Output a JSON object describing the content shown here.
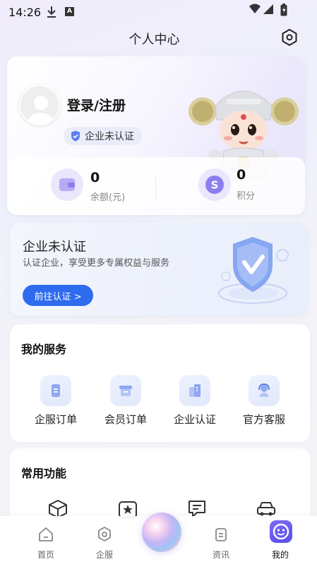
{
  "status_bar": {
    "time": "14:26"
  },
  "header": {
    "title": "个人中心"
  },
  "profile": {
    "login_text": "登录/注册",
    "cert_badge": "企业未认证",
    "balance_value": "0",
    "balance_label": "余额(元)",
    "points_value": "0",
    "points_label": "积分"
  },
  "enterprise": {
    "title": "企业未认证",
    "subtitle": "认证企业，享受更多专属权益与服务",
    "button": "前往认证 >"
  },
  "services": {
    "title": "我的服务",
    "items": [
      {
        "label": "企服订单",
        "icon": "document-icon"
      },
      {
        "label": "会员订单",
        "icon": "box-icon"
      },
      {
        "label": "企业认证",
        "icon": "building-icon"
      },
      {
        "label": "官方客服",
        "icon": "headset-icon"
      }
    ]
  },
  "functions": {
    "title": "常用功能",
    "icons": [
      "package-icon",
      "star-tag-icon",
      "message-icon",
      "car-icon"
    ]
  },
  "nav": {
    "items": [
      {
        "label": "首页",
        "icon": "home-icon"
      },
      {
        "label": "企服",
        "icon": "service-icon"
      },
      {
        "label": "资讯",
        "icon": "news-icon"
      },
      {
        "label": "我的",
        "icon": "mine-icon"
      }
    ],
    "active": "我的"
  },
  "colors": {
    "accent": "#2f6bee",
    "brand_purple": "#6a5cf0"
  }
}
